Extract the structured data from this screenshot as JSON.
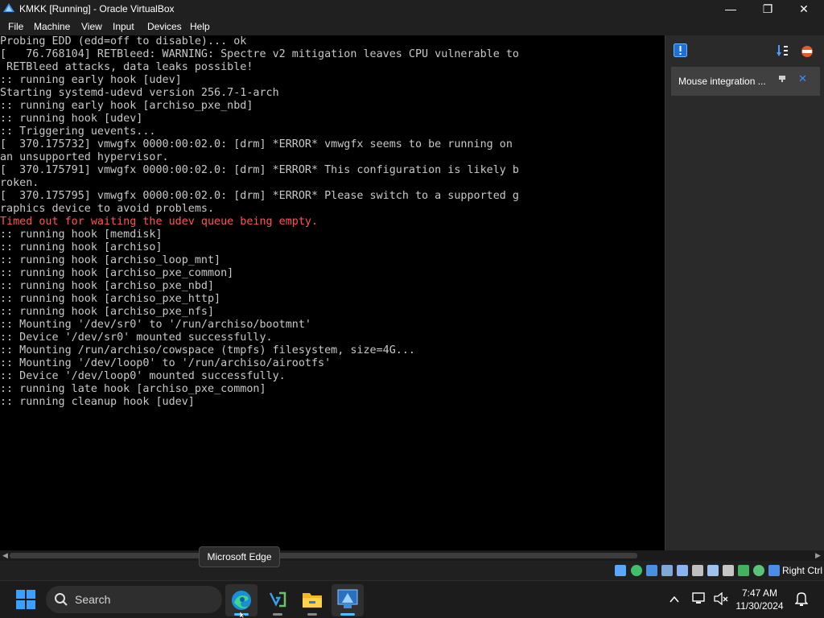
{
  "window": {
    "title": "KMKK [Running] - Oracle VirtualBox",
    "minimize_glyph": "—",
    "maximize_glyph": "❐",
    "close_glyph": "✕"
  },
  "menu": {
    "items": [
      "File",
      "Machine",
      "View",
      "Input",
      "Devices",
      "Help"
    ]
  },
  "console": {
    "lines": [
      {
        "text": "Probing EDD (edd=off to disable)... ok",
        "error": false
      },
      {
        "text": "[   76.768104] RETBleed: WARNING: Spectre v2 mitigation leaves CPU vulnerable to",
        "error": false
      },
      {
        "text": " RETBleed attacks, data leaks possible!",
        "error": false
      },
      {
        "text": ":: running early hook [udev]",
        "error": false
      },
      {
        "text": "Starting systemd-udevd version 256.7-1-arch",
        "error": false
      },
      {
        "text": ":: running early hook [archiso_pxe_nbd]",
        "error": false
      },
      {
        "text": ":: running hook [udev]",
        "error": false
      },
      {
        "text": ":: Triggering uevents...",
        "error": false
      },
      {
        "text": "[  370.175732] vmwgfx 0000:00:02.0: [drm] *ERROR* vmwgfx seems to be running on",
        "error": false
      },
      {
        "text": "an unsupported hypervisor.",
        "error": false
      },
      {
        "text": "[  370.175791] vmwgfx 0000:00:02.0: [drm] *ERROR* This configuration is likely b",
        "error": false
      },
      {
        "text": "roken.",
        "error": false
      },
      {
        "text": "[  370.175795] vmwgfx 0000:00:02.0: [drm] *ERROR* Please switch to a supported g",
        "error": false
      },
      {
        "text": "raphics device to avoid problems.",
        "error": false
      },
      {
        "text": "Timed out for waiting the udev queue being empty.",
        "error": true
      },
      {
        "text": ":: running hook [memdisk]",
        "error": false
      },
      {
        "text": ":: running hook [archiso]",
        "error": false
      },
      {
        "text": ":: running hook [archiso_loop_mnt]",
        "error": false
      },
      {
        "text": ":: running hook [archiso_pxe_common]",
        "error": false
      },
      {
        "text": ":: running hook [archiso_pxe_nbd]",
        "error": false
      },
      {
        "text": ":: running hook [archiso_pxe_http]",
        "error": false
      },
      {
        "text": ":: running hook [archiso_pxe_nfs]",
        "error": false
      },
      {
        "text": ":: Mounting '/dev/sr0' to '/run/archiso/bootmnt'",
        "error": false
      },
      {
        "text": ":: Device '/dev/sr0' mounted successfully.",
        "error": false
      },
      {
        "text": ":: Mounting /run/archiso/cowspace (tmpfs) filesystem, size=4G...",
        "error": false
      },
      {
        "text": ":: Mounting '/dev/loop0' to '/run/archiso/airootfs'",
        "error": false
      },
      {
        "text": ":: Device '/dev/loop0' mounted successfully.",
        "error": false
      },
      {
        "text": ":: running late hook [archiso_pxe_common]",
        "error": false
      },
      {
        "text": ":: running cleanup hook [udev]",
        "error": false
      }
    ]
  },
  "side_panel": {
    "notification": {
      "label": "Mouse integration ...",
      "close_glyph": "✕"
    }
  },
  "status_bar": {
    "host_key": "Right Ctrl"
  },
  "tooltip": {
    "text": "Microsoft Edge"
  },
  "taskbar": {
    "search_label": "Search",
    "clock_time": "7:47 AM",
    "clock_date": "11/30/2024"
  },
  "colors": {
    "console_text": "#c8c8c8",
    "console_error": "#ff5353",
    "accent": "#4cc2ff",
    "windows_blue": "#3aa0ff"
  }
}
